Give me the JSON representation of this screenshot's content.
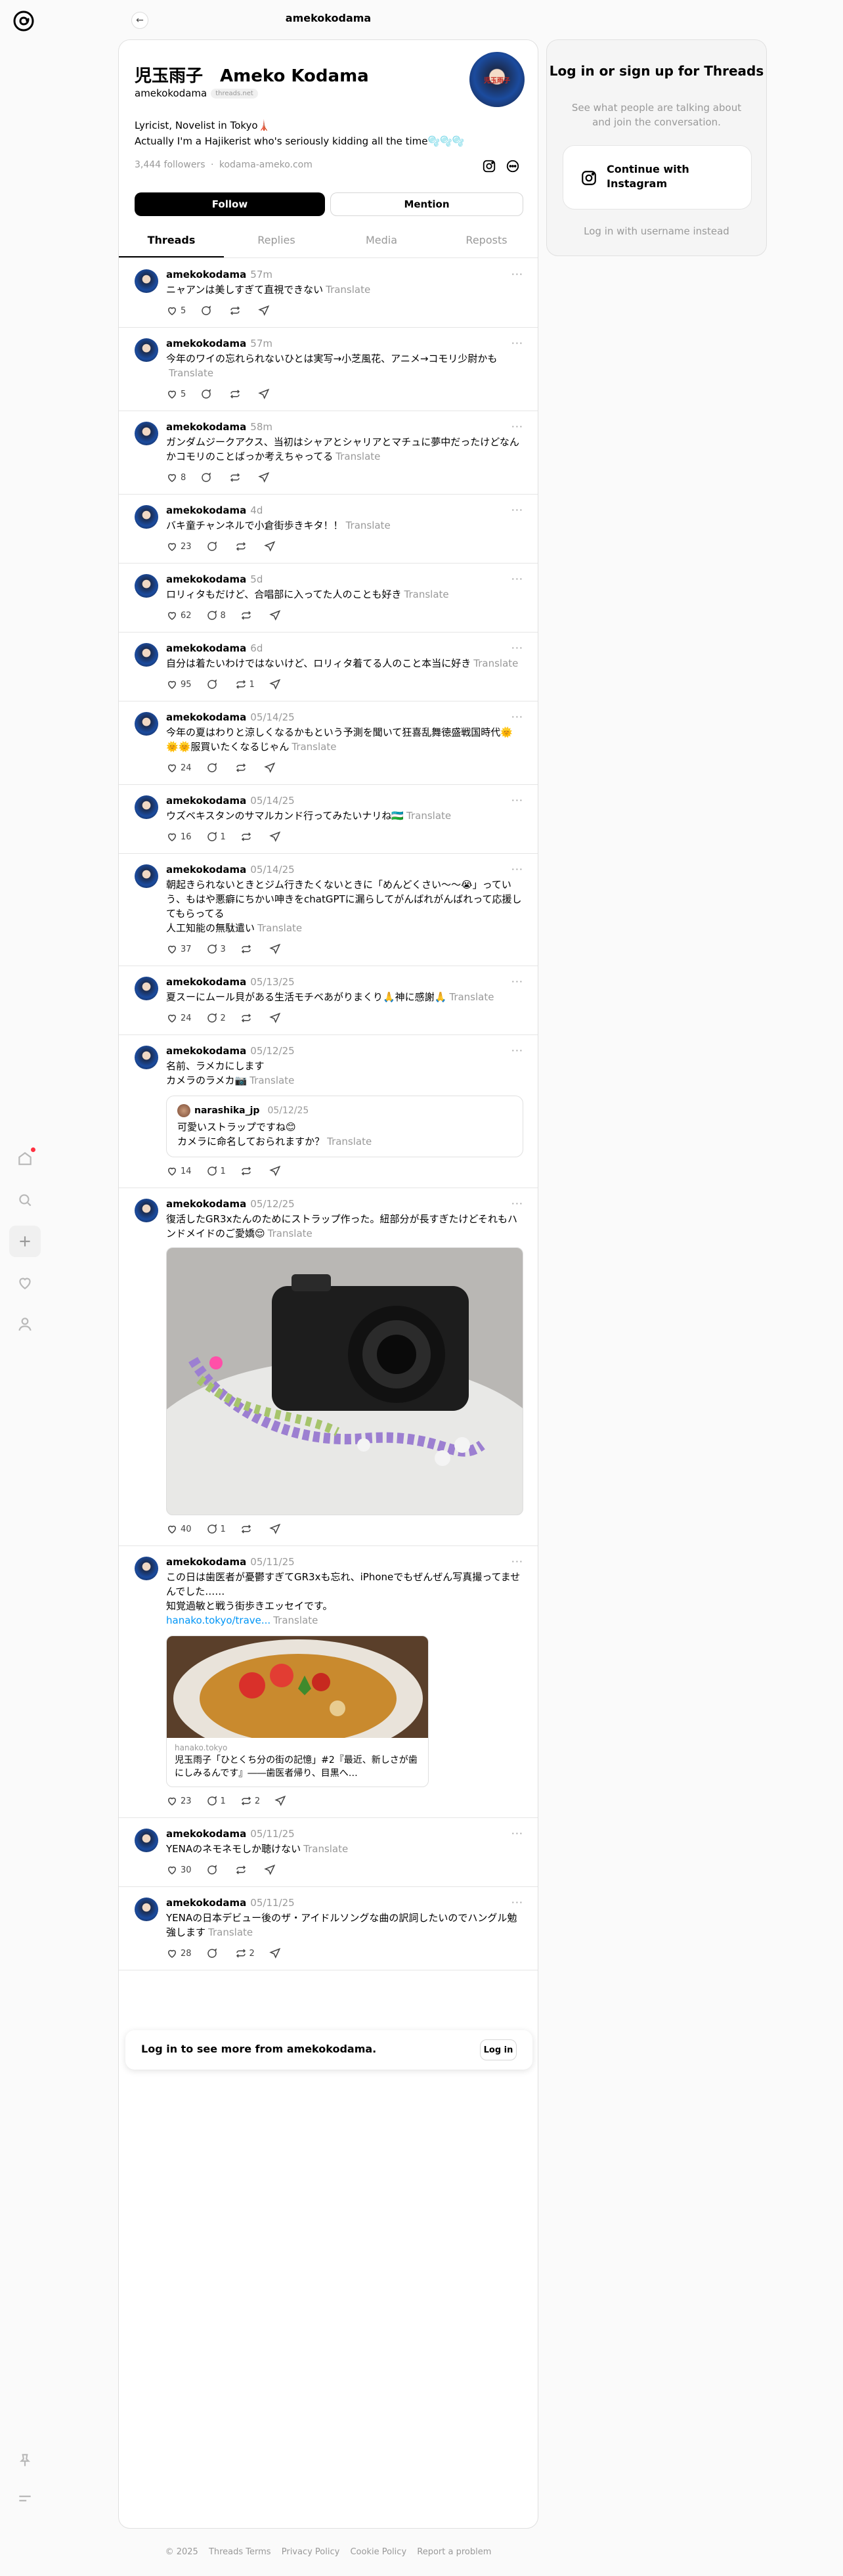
{
  "app": {
    "header_username": "amekokodama"
  },
  "nav": {
    "items": [
      {
        "name": "home-icon"
      },
      {
        "name": "search-icon"
      },
      {
        "name": "create-icon"
      },
      {
        "name": "activity-heart-icon"
      },
      {
        "name": "profile-icon"
      },
      {
        "name": "pin-icon"
      },
      {
        "name": "menu-icon"
      }
    ]
  },
  "profile": {
    "display_name": "児玉雨子　Ameko Kodama",
    "handle": "amekokodama",
    "badge": "threads.net",
    "bio_line1": "Lyricist, Novelist in Tokyo🗼",
    "bio_line2": "Actually I'm a Hajikerist who's seriously kidding all the time🫧🫧🫧",
    "followers": "3,444 followers",
    "separator": "·",
    "website": "kodama-ameko.com",
    "follow_label": "Follow",
    "mention_label": "Mention",
    "avatar_text": "児玉雨子"
  },
  "tabs": [
    "Threads",
    "Replies",
    "Media",
    "Reposts"
  ],
  "translate_label": "Translate",
  "posts": [
    {
      "user": "amekokodama",
      "time": "57m",
      "text": "ニャアンは美しすぎて直視できない",
      "likes": "5",
      "replies": "",
      "reposts": ""
    },
    {
      "user": "amekokodama",
      "time": "57m",
      "text": "今年のワイの忘れられないひとは実写→小芝風花、アニメ→コモリ少尉かも",
      "likes": "5",
      "replies": "",
      "reposts": ""
    },
    {
      "user": "amekokodama",
      "time": "58m",
      "text": "ガンダムジークアクス、当初はシャアとシャリアとマチュに夢中だったけどなんかコモリのことばっか考えちゃってる",
      "likes": "8",
      "replies": "",
      "reposts": ""
    },
    {
      "user": "amekokodama",
      "time": "4d",
      "text": "バキ童チャンネルで小倉街歩きキタ！！",
      "likes": "23",
      "replies": "",
      "reposts": ""
    },
    {
      "user": "amekokodama",
      "time": "5d",
      "text": "ロリィタもだけど、合唱部に入ってた人のことも好き",
      "likes": "62",
      "replies": "8",
      "reposts": ""
    },
    {
      "user": "amekokodama",
      "time": "6d",
      "text": "自分は着たいわけではないけど、ロリィタ着てる人のこと本当に好き",
      "likes": "95",
      "replies": "",
      "reposts": "1"
    },
    {
      "user": "amekokodama",
      "time": "05/14/25",
      "text": "今年の夏はわりと涼しくなるかもという予測を聞いて狂喜乱舞徳盛戦国時代🌞🌞🌞服買いたくなるじゃん",
      "likes": "24",
      "replies": "",
      "reposts": ""
    },
    {
      "user": "amekokodama",
      "time": "05/14/25",
      "text": "ウズベキスタンのサマルカンド行ってみたいナリね🇺🇿",
      "likes": "16",
      "replies": "1",
      "reposts": ""
    },
    {
      "user": "amekokodama",
      "time": "05/14/25",
      "text": "朝起きられないときとジム行きたくないときに「めんどくさい〜〜😭」っていう、もはや悪癖にちかい呻きをchatGPTに漏らしてがんばれがんばれって応援してもらってる\n人工知能の無駄遣い",
      "likes": "37",
      "replies": "3",
      "reposts": ""
    },
    {
      "user": "amekokodama",
      "time": "05/13/25",
      "text": "夏スーにムール貝がある生活モチベあがりまくり🙏神に感謝🙏",
      "likes": "24",
      "replies": "2",
      "reposts": ""
    },
    {
      "user": "amekokodama",
      "time": "05/12/25",
      "text": "名前、ラメカにします\nカメラのラメカ📷",
      "likes": "14",
      "replies": "1",
      "reposts": "",
      "quote": {
        "user": "narashika_jp",
        "time": "05/12/25",
        "text": "可愛いストラップですね😊\nカメラに命名しておられますか？"
      }
    },
    {
      "user": "amekokodama",
      "time": "05/12/25",
      "text": "復活したGR3xたんのためにストラップ作った。紐部分が長すぎたけどそれもハンドメイドのご愛嬌😌",
      "likes": "40",
      "replies": "1",
      "reposts": ""
    },
    {
      "user": "amekokodama",
      "time": "05/11/25",
      "text": "この日は歯医者が憂鬱すぎてGR3xも忘れ、iPhoneでもぜんぜん写真撮ってませんでした……\n知覚過敏と戦う街歩きエッセイです。",
      "link": "hanako.tokyo/trave...",
      "likes": "23",
      "replies": "1",
      "reposts": "2",
      "linkcard": {
        "source": "hanako.tokyo",
        "title": "児玉雨子「ひとくち分の街の記憶」#2『最近、新しさが歯にしみるんです』――歯医者帰り、目黒へ…"
      }
    },
    {
      "user": "amekokodama",
      "time": "05/11/25",
      "text": "YENAのネモネモしか聴けない",
      "likes": "30",
      "replies": "",
      "reposts": ""
    },
    {
      "user": "amekokodama",
      "time": "05/11/25",
      "text": "YENAの日本デビュー後のザ・アイドルソングな曲の訳詞したいのでハングル勉強します",
      "likes": "28",
      "replies": "",
      "reposts": "2"
    }
  ],
  "login_strip": {
    "text": "Log in to see more from amekokodama.",
    "button": "Log in"
  },
  "sidebar": {
    "title": "Log in or sign up for Threads",
    "subtitle": "See what people are talking about and join the conversation.",
    "instagram_button": "Continue with Instagram",
    "alt_login": "Log in with username instead"
  },
  "footer": [
    "© 2025",
    "Threads Terms",
    "Privacy Policy",
    "Cookie Policy",
    "Report a problem"
  ],
  "colors": {
    "accent": "#000000",
    "muted": "#999999",
    "link": "#0095f6",
    "notification_dot": "#ff3040"
  }
}
